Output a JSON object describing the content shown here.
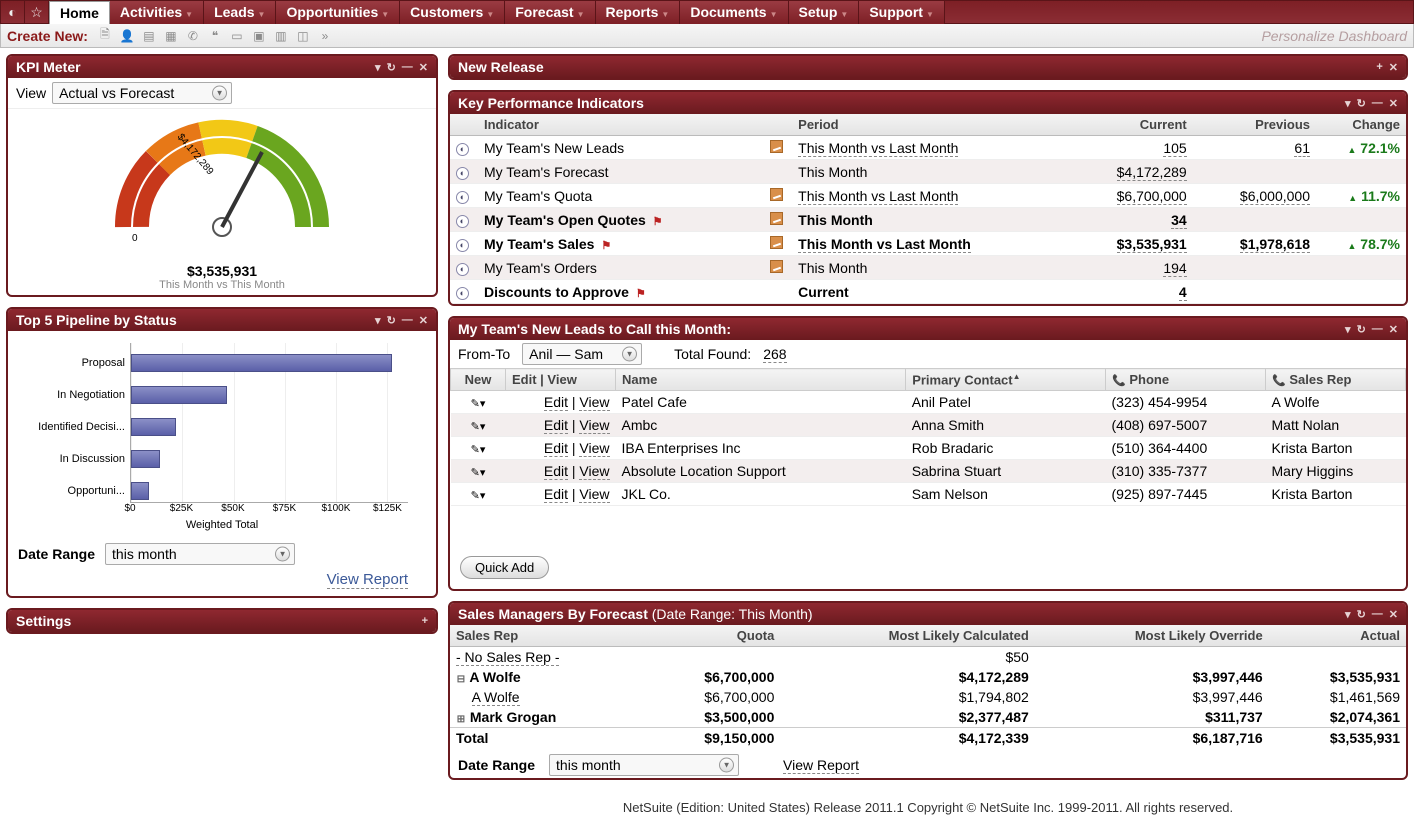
{
  "nav": {
    "tabs": [
      "Home",
      "Activities",
      "Leads",
      "Opportunities",
      "Customers",
      "Forecast",
      "Reports",
      "Documents",
      "Setup",
      "Support"
    ],
    "active": "Home"
  },
  "subbar": {
    "create_new": "Create New:",
    "personalize": "Personalize Dashboard"
  },
  "kpi_meter": {
    "title": "KPI Meter",
    "view_label": "View",
    "view_value": "Actual vs Forecast",
    "target_label": "$4,172,289",
    "value_label": "$3,535,931",
    "sub_label": "This Month vs This Month",
    "zero_label": "0"
  },
  "pipeline": {
    "title": "Top 5 Pipeline by Status",
    "axis_label": "Weighted Total",
    "ticks": [
      "$0",
      "$25K",
      "$50K",
      "$75K",
      "$100K",
      "$125K"
    ],
    "rows": [
      {
        "label": "Proposal",
        "value": 127000
      },
      {
        "label": "In Negotiation",
        "value": 47000
      },
      {
        "label": "Identified Decisi...",
        "value": 22000
      },
      {
        "label": "In Discussion",
        "value": 14000
      },
      {
        "label": "Opportuni...",
        "value": 9000
      }
    ],
    "max": 135000,
    "date_range_label": "Date Range",
    "date_range_value": "this month",
    "view_report": "View Report"
  },
  "settings": {
    "title": "Settings"
  },
  "new_release": {
    "title": "New Release"
  },
  "kpi_table": {
    "title": "Key Performance Indicators",
    "columns": [
      "Indicator",
      "Period",
      "Current",
      "Previous",
      "Change"
    ],
    "rows": [
      {
        "indicator": "My Team's New Leads",
        "period": "This Month vs Last Month",
        "period_link": true,
        "trend": true,
        "current": "105",
        "previous": "61",
        "change": "72.1%",
        "up": true
      },
      {
        "indicator": "My Team's Forecast",
        "period": "This Month",
        "current": "$4,172,289"
      },
      {
        "indicator": "My Team's Quota",
        "period": "This Month vs Last Month",
        "period_link": true,
        "trend": true,
        "current": "$6,700,000",
        "previous": "$6,000,000",
        "change": "11.7%",
        "up": true
      },
      {
        "indicator": "My Team's Open Quotes",
        "flag": true,
        "period": "This Month",
        "trend": true,
        "current": "34",
        "bold": true
      },
      {
        "indicator": "My Team's Sales",
        "flag": true,
        "period": "This Month vs Last Month",
        "period_link": true,
        "trend": true,
        "current": "$3,535,931",
        "previous": "$1,978,618",
        "change": "78.7%",
        "up": true,
        "bold": true
      },
      {
        "indicator": "My Team's Orders",
        "period": "This Month",
        "trend": true,
        "current": "194"
      },
      {
        "indicator": "Discounts to Approve",
        "flag": true,
        "period": "Current",
        "current": "4",
        "bold": true
      }
    ]
  },
  "leads": {
    "title": "My Team's New Leads to Call this Month:",
    "from_to_label": "From-To",
    "from_to_value": "Anil — Sam",
    "total_found_label": "Total Found:",
    "total_found": "268",
    "columns": [
      "New",
      "Edit | View",
      "Name",
      "Primary Contact",
      "Phone",
      "Sales Rep"
    ],
    "edit_label": "Edit",
    "view_label": "View",
    "rows": [
      {
        "name": "Patel Cafe",
        "contact": "Anil Patel",
        "phone": "(323) 454-9954",
        "rep": "A Wolfe"
      },
      {
        "name": "Ambc",
        "contact": "Anna Smith",
        "phone": "(408) 697-5007",
        "rep": "Matt Nolan"
      },
      {
        "name": "IBA Enterprises Inc",
        "contact": "Rob Bradaric",
        "phone": "(510) 364-4400",
        "rep": "Krista Barton"
      },
      {
        "name": "Absolute Location Support",
        "contact": "Sabrina Stuart",
        "phone": "(310) 335-7377",
        "rep": "Mary Higgins"
      },
      {
        "name": "JKL Co.",
        "contact": "Sam Nelson",
        "phone": "(925) 897-7445",
        "rep": "Krista Barton"
      }
    ],
    "quick_add": "Quick Add"
  },
  "sales_mgr": {
    "title": "Sales Managers By Forecast",
    "subtitle": "(Date Range: This Month)",
    "columns": [
      "Sales Rep",
      "Quota",
      "Most Likely Calculated",
      "Most Likely Override",
      "Actual"
    ],
    "rows": [
      {
        "rep": "- No Sales Rep -",
        "link": true,
        "quota": "",
        "calc": "$50",
        "override": "",
        "actual": ""
      },
      {
        "rep": "A Wolfe",
        "tree": "-",
        "bold": true,
        "quota": "$6,700,000",
        "calc": "$4,172,289",
        "override": "$3,997,446",
        "actual": "$3,535,931"
      },
      {
        "rep": "A Wolfe",
        "indent": 1,
        "link": true,
        "quota": "$6,700,000",
        "calc": "$1,794,802",
        "override": "$3,997,446",
        "actual": "$1,461,569"
      },
      {
        "rep": "Mark Grogan",
        "tree": "+",
        "bold": true,
        "quota": "$3,500,000",
        "calc": "$2,377,487",
        "override": "$311,737",
        "actual": "$2,074,361"
      }
    ],
    "total_row": {
      "label": "Total",
      "quota": "$9,150,000",
      "calc": "$4,172,339",
      "override": "$6,187,716",
      "actual": "$3,535,931"
    },
    "date_range_label": "Date Range",
    "date_range_value": "this month",
    "view_report": "View Report"
  },
  "footer": "NetSuite (Edition: United States) Release 2011.1 Copyright © NetSuite Inc. 1999-2011. All rights reserved.",
  "chart_data": [
    {
      "type": "bar",
      "orientation": "horizontal",
      "title": "Top 5 Pipeline by Status",
      "xlabel": "Weighted Total",
      "ylabel": "",
      "xlim": [
        0,
        135000
      ],
      "x_ticks": [
        0,
        25000,
        50000,
        75000,
        100000,
        125000
      ],
      "categories": [
        "Proposal",
        "In Negotiation",
        "Identified Decision Makers",
        "In Discussion",
        "Opportunity"
      ],
      "values": [
        127000,
        47000,
        22000,
        14000,
        9000
      ]
    },
    {
      "type": "gauge",
      "title": "KPI Meter — Actual vs Forecast",
      "min": 0,
      "max": 4172289,
      "value": 3535931,
      "segments": [
        {
          "color": "red"
        },
        {
          "color": "orange"
        },
        {
          "color": "yellow"
        },
        {
          "color": "green"
        }
      ],
      "value_label": "$3,535,931",
      "max_label": "$4,172,289",
      "sub_label": "This Month vs This Month"
    }
  ]
}
